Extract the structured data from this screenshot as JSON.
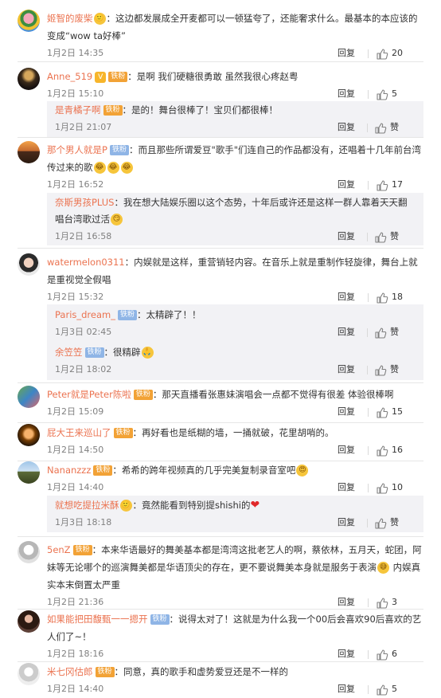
{
  "c1": {
    "user": "姬智的废柴",
    "badge": "",
    "text": "：这边都发展成全开麦都可以一顿猛夸了，还能奢求什么。最基本的本应该的变成“wow ta好棒”",
    "time": "1月2日 14:35",
    "reply": "回复",
    "likes": "20"
  },
  "c2": {
    "user": "Anne_519",
    "badge": "铁粉",
    "text": "：是啊  我们硬糖很勇敢  虽然我很心疼赵粤",
    "time": "1月2日 15:10",
    "reply": "回复",
    "likes": "5",
    "sub": [
      {
        "user": "是青橘子啊",
        "badge": "铁粉",
        "text": "：是的！舞台很棒了！宝贝们都很棒！",
        "time": "1月2日 21:07",
        "reply": "回复",
        "likes": "赞"
      }
    ]
  },
  "c3": {
    "user": "那个男人就是P",
    "badge": "铁粉",
    "text": "：而且那些所谓爱豆\"歌手\"们连自己的作品都没有，还唱着十几年前台湾传过来的歌",
    "time": "1月2日 16:52",
    "reply": "回复",
    "likes": "17",
    "sub": [
      {
        "user": "奈斯男孩PLUS",
        "badge": "",
        "text": "：我在想大陆娱乐圈以这个态势，十年后或许还是这样一群人靠着天天翻唱台湾歌过活",
        "time": "1月2日 16:58",
        "reply": "回复",
        "likes": "赞"
      }
    ]
  },
  "c4": {
    "user": "watermelon0311",
    "badge": "",
    "text": "：内娱就是这样，重营销轻内容。在音乐上就是重制作轻旋律，舞台上就是重视觉全假唱",
    "time": "1月2日 15:32",
    "reply": "回复",
    "likes": "18",
    "sub": [
      {
        "user": "Paris_dream_",
        "badge": "铁粉",
        "text": "：太精辟了！！",
        "time": "1月3日 02:45",
        "reply": "回复",
        "likes": "赞"
      },
      {
        "user": "余笠笠",
        "badge": "铁粉",
        "text": "：很精辟",
        "time": "1月2日 18:02",
        "reply": "回复",
        "likes": "赞"
      }
    ]
  },
  "c5": {
    "user": "Peter就是Peter陈啦",
    "badge": "铁粉",
    "text": "：那天直播看张惠妹演唱会一点都不觉得有很差 体验很棒啊",
    "time": "1月2日 15:09",
    "reply": "回复",
    "likes": "15"
  },
  "c6": {
    "user": "屁大王来巡山了",
    "badge": "铁粉",
    "text": "：再好看也是纸糊的墙，一捅就破，花里胡哨的。",
    "time": "1月2日 14:50",
    "reply": "回复",
    "likes": "16"
  },
  "c7": {
    "user": "Nananzzz",
    "badge": "铁粉",
    "text": "：希希的跨年视频真的几乎完美复制录音室吧",
    "time": "1月2日 14:40",
    "reply": "回复",
    "likes": "10",
    "sub": [
      {
        "user": "就想吃提拉米酥",
        "badge": "",
        "text": "：竟然能看到特别提shishi的",
        "time": "1月3日 18:18",
        "reply": "回复",
        "likes": "赞"
      }
    ]
  },
  "c8": {
    "user": "5enZ",
    "badge": "铁粉",
    "text": "：本来华语最好的舞美基本都是湾湾这批老艺人的啊，蔡依林，五月天，蛇团，阿妹等无论哪个的巡演舞美都是华语顶尖的存在，更不要说舞美本身就是服务于表演",
    "text2": " 内娱真实本末倒置太严重",
    "time": "1月2日 21:36",
    "reply": "回复",
    "likes": "3"
  },
  "c9": {
    "user": "如果能把田馥甄一一摁开",
    "badge": "铁粉",
    "text": "：说得太对了！这就是为什么我一个00后会喜欢90后喜欢的艺人们了~！",
    "time": "1月2日 18:16",
    "reply": "回复",
    "likes": "6"
  },
  "c10": {
    "user": "米七冈估郎",
    "badge": "铁粉",
    "text": "：同意，真的歌手和虚势爱豆还是不一样的",
    "time": "1月2日 14:40",
    "reply": "回复",
    "likes": "5"
  },
  "colors": {
    "username": "#eb7350",
    "meta": "#808080",
    "subBg": "#f2f2f5"
  }
}
